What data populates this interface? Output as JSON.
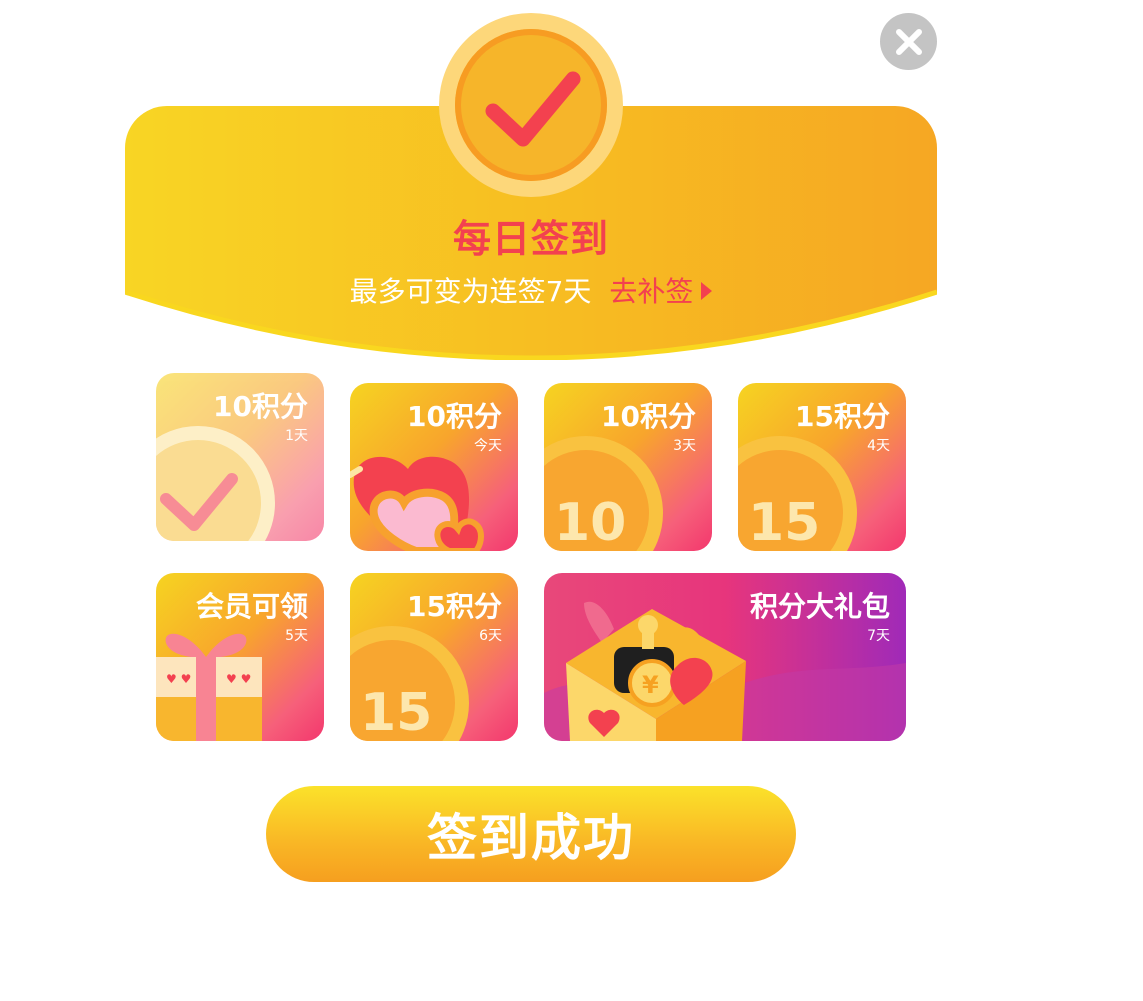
{
  "header": {
    "title": "每日签到",
    "subtitle": "最多可变为连签7天",
    "makeup_label": "去补签"
  },
  "cards": [
    {
      "points": "10积分",
      "day": "1天",
      "state": "claimed",
      "art": "check"
    },
    {
      "points": "10积分",
      "day": "今天",
      "state": "today",
      "art": "heart"
    },
    {
      "points": "10积分",
      "day": "3天",
      "state": "upcoming",
      "art": "coin",
      "coin_value": "10"
    },
    {
      "points": "15积分",
      "day": "4天",
      "state": "upcoming",
      "art": "coin",
      "coin_value": "15"
    },
    {
      "points": "会员可领",
      "day": "5天",
      "state": "upcoming",
      "art": "gift"
    },
    {
      "points": "15积分",
      "day": "6天",
      "state": "upcoming",
      "art": "coin",
      "coin_value": "15"
    },
    {
      "points": "积分大礼包",
      "day": "7天",
      "state": "upcoming",
      "art": "giftbox"
    }
  ],
  "cta": {
    "label": "签到成功"
  },
  "colors": {
    "accent_red": "#f3414f",
    "gold": "#f7bc22",
    "close_gray": "#c4c4c4"
  },
  "icons": {
    "close": "close-icon",
    "check": "check-icon",
    "arrow": "triangle-right-icon"
  }
}
